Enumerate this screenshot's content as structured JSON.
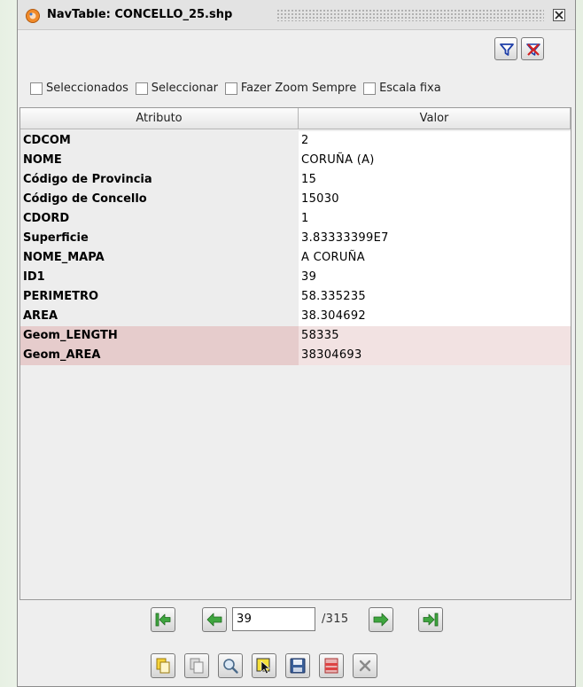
{
  "window": {
    "title": "NavTable: CONCELLO_25.shp"
  },
  "options": [
    {
      "label": "Seleccionados",
      "checked": false
    },
    {
      "label": "Seleccionar",
      "checked": false
    },
    {
      "label": "Fazer Zoom Sempre",
      "checked": false
    },
    {
      "label": "Escala fixa",
      "checked": false
    }
  ],
  "table": {
    "headers": {
      "attribute": "Atributo",
      "value": "Valor"
    },
    "rows": [
      {
        "attr": "CDCOM",
        "value": "2"
      },
      {
        "attr": "NOME",
        "value": "CORUÑA (A)"
      },
      {
        "attr": "Código de Provincia",
        "value": "15"
      },
      {
        "attr": "Código de Concello",
        "value": "15030"
      },
      {
        "attr": "CDORD",
        "value": "1"
      },
      {
        "attr": "Superficie",
        "value": "3.83333399E7"
      },
      {
        "attr": "NOME_MAPA",
        "value": "A CORUÑA"
      },
      {
        "attr": "ID1",
        "value": "39"
      },
      {
        "attr": "PERIMETRO",
        "value": "58.335235"
      },
      {
        "attr": "AREA",
        "value": "38.304692"
      },
      {
        "attr": "Geom_LENGTH",
        "value": "58335"
      },
      {
        "attr": "Geom_AREA",
        "value": "38304693"
      }
    ]
  },
  "navigation": {
    "current_record": "39",
    "total": "/315"
  },
  "icons": {
    "filter": "filter-icon",
    "clear_filter": "clear-filter-icon",
    "first": "first-record-icon",
    "previous": "previous-record-icon",
    "next": "next-record-icon",
    "last": "last-record-icon",
    "copy_selected": "copy-selected-icon",
    "copy_previous": "copy-previous-icon",
    "zoom": "zoom-icon",
    "select": "select-icon",
    "save": "save-icon",
    "delete": "delete-record-icon",
    "close": "close-icon"
  },
  "colors": {
    "nav_arrow": "#3fa63f",
    "geom_row_attr": "#e6cccc",
    "geom_row_value": "#f2e2e2"
  }
}
